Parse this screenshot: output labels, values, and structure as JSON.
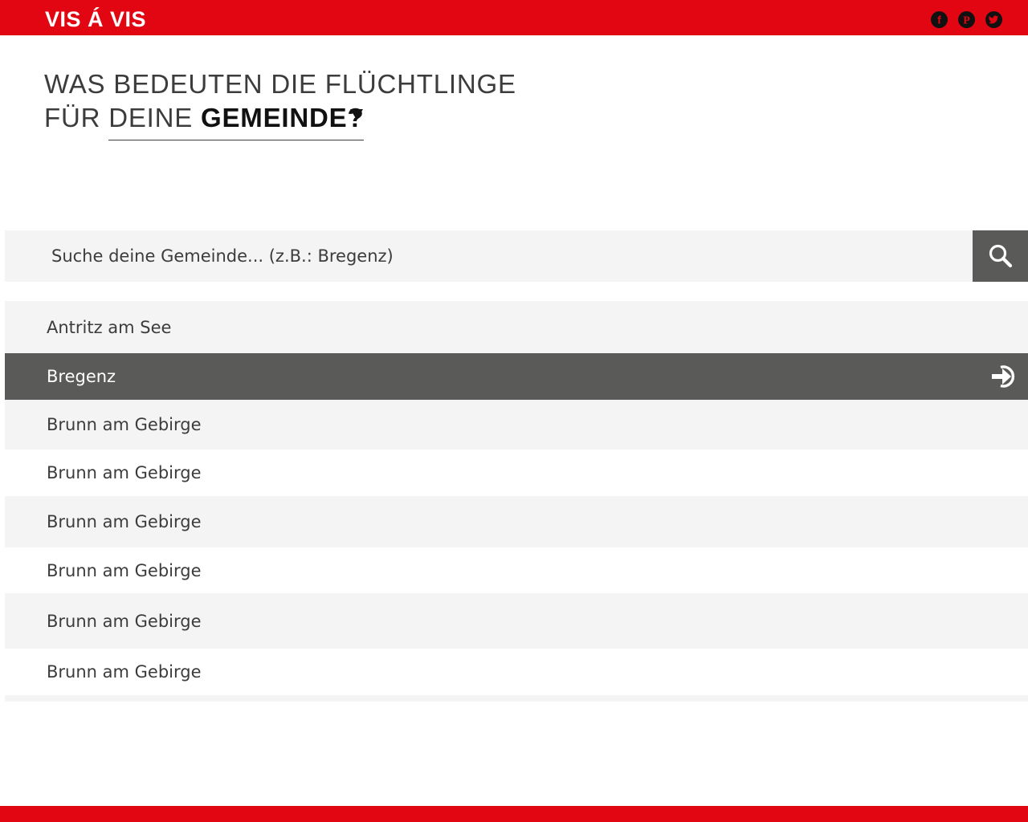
{
  "header": {
    "brand": "VIS Á VIS",
    "social": [
      {
        "icon": "facebook-icon",
        "glyph": "f"
      },
      {
        "icon": "pinterest-icon",
        "glyph": "P"
      },
      {
        "icon": "twitter-icon",
        "glyph": "t"
      }
    ]
  },
  "headline": {
    "line1": "WAS BEDEUTEN DIE FLÜCHTLINGE",
    "line2_prefix": "FÜR",
    "select_word": "DEINE",
    "select_value": "GEMEINDE?"
  },
  "search": {
    "placeholder": "Suche deine Gemeinde... (z.B.: Bregenz)",
    "value": ""
  },
  "results": [
    {
      "label": "Antritz am See",
      "active": false
    },
    {
      "label": "Bregenz",
      "active": true
    },
    {
      "label": "Brunn am Gebirge",
      "active": false
    },
    {
      "label": "Brunn am Gebirge",
      "active": false
    },
    {
      "label": "Brunn am Gebirge",
      "active": false
    },
    {
      "label": "Brunn am Gebirge",
      "active": false
    },
    {
      "label": "Brunn am Gebirge",
      "active": false
    },
    {
      "label": "Brunn am Gebirge",
      "active": false
    }
  ],
  "colors": {
    "brand_red": "#e20613",
    "dark_grey": "#5a5a59",
    "light_grey": "#f4f4f4",
    "text": "#3c3c3c"
  }
}
